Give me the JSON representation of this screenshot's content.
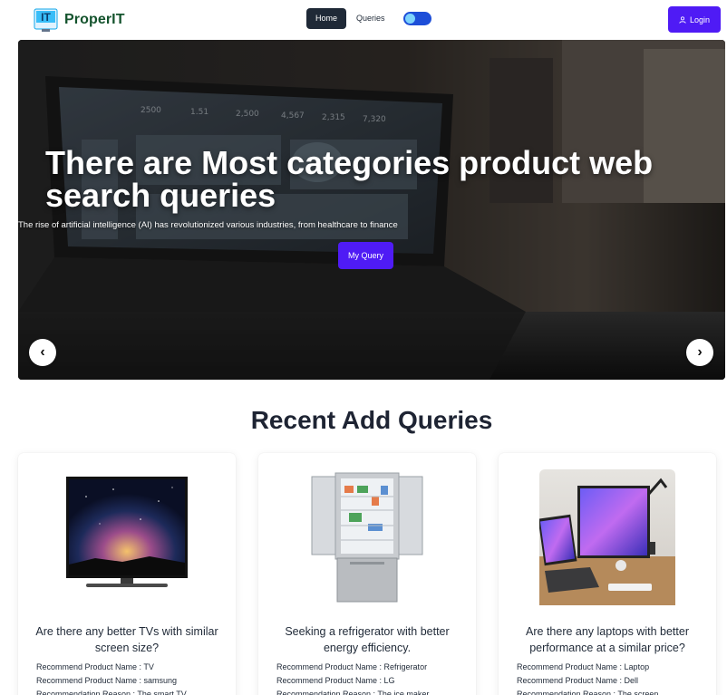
{
  "navbar": {
    "brand": "ProperIT",
    "logo_text": "IT",
    "links": {
      "home": "Home",
      "queries": "Queries"
    },
    "login": "Login"
  },
  "hero": {
    "title": "There are Most categories product web search queries",
    "subtitle": "The rise of artificial intelligence (AI) has revolutionized various industries, from healthcare to finance",
    "button": "My Query",
    "prev_icon": "chevron-left-icon",
    "next_icon": "chevron-right-icon",
    "laptop_stats": [
      "2500",
      "1.51",
      "2,500",
      "4,567",
      "2,315",
      "7,320"
    ]
  },
  "recent": {
    "title": "Recent Add Queries",
    "cards": [
      {
        "question": "Are there any better TVs with similar screen size?",
        "lines": [
          "Recommend Product Name : TV",
          "Recommend Product Name : samsung",
          "Recommendation Reason : The smart TV"
        ]
      },
      {
        "question": "Seeking a refrigerator with better energy efficiency.",
        "lines": [
          "Recommend Product Name : Refrigerator",
          "Recommend Product Name : LG",
          "Recommendation Reason : The ice maker"
        ]
      },
      {
        "question": "Are there any laptops with better performance at a similar price?",
        "lines": [
          "Recommend Product Name : Laptop",
          "Recommend Product Name : Dell",
          "Recommendation Reason : The screen"
        ]
      }
    ]
  },
  "colors": {
    "accent": "#4f1bf5",
    "brand": "#14532d",
    "toggle": "#1d4ed8"
  }
}
